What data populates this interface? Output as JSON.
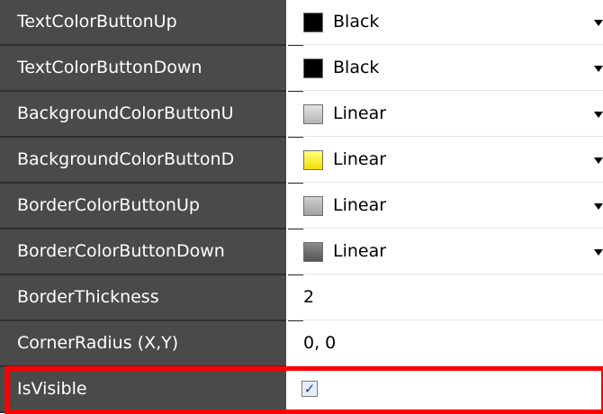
{
  "properties": [
    {
      "name": "TextColorButtonUp",
      "value": "Black",
      "type": "color",
      "swatch": "#000000"
    },
    {
      "name": "TextColorButtonDown",
      "value": "Black",
      "type": "color",
      "swatch": "#000000"
    },
    {
      "name": "BackgroundColorButtonU",
      "value": "Linear",
      "type": "color",
      "swatch": "#c8c8c8"
    },
    {
      "name": "BackgroundColorButtonD",
      "value": "Linear",
      "type": "color",
      "swatch": "#ffff40"
    },
    {
      "name": "BorderColorButtonUp",
      "value": "Linear",
      "type": "color",
      "swatch": "#b0b0b0"
    },
    {
      "name": "BorderColorButtonDown",
      "value": "Linear",
      "type": "color",
      "swatch": "#6a6a6a"
    },
    {
      "name": "BorderThickness",
      "value": "2",
      "type": "text"
    },
    {
      "name": "CornerRadius (X,Y)",
      "value": "0, 0",
      "type": "text"
    },
    {
      "name": "IsVisible",
      "value": true,
      "type": "checkbox",
      "check_glyph": "✓"
    }
  ],
  "colors": {
    "name_bg": "#4a4a4a",
    "highlight": "#ff0000"
  },
  "icons": {
    "dropdown": "chevron-down-icon",
    "checkbox": "checkbox-checked-icon"
  }
}
